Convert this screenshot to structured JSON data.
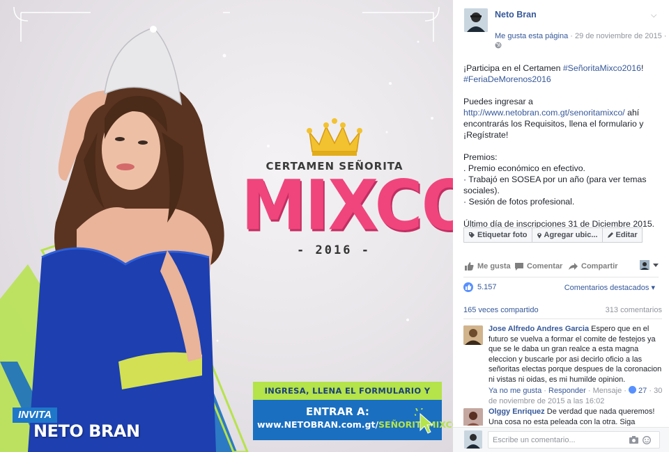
{
  "photo": {
    "certamen_title": "CERTAMEN SEÑORITA",
    "mixco_word": "MIXCO",
    "year": "- 2016 -",
    "ingresa_band": "INGRESA, LLENA EL FORMULARIO Y ¡REGÍSTRATE!",
    "entrar_label": "ENTRAR A:",
    "entrar_url_prefix": "www.NETOBRAN.com.gt/",
    "entrar_url_highlight": "SEÑORITAMIXCO",
    "invita_label": "INVITA",
    "neto_bran_label": "NETO BRAN",
    "colors": {
      "pink": "#f0457c",
      "blue": "#1a6fc0",
      "lime": "#b4e34a",
      "crown_gold": "#f2c230"
    }
  },
  "post": {
    "author": "Neto Bran",
    "like_page": "Me gusta esta página",
    "date": " · 29 de noviembre de 2015 · ",
    "privacy_icon": "globe-icon",
    "text": {
      "line1_prefix": "¡Participa en el Certamen ",
      "hashtag1": "#SeñoritaMixco2016",
      "line1_suffix": "! ",
      "hashtag2": "#FeriaDeMorenos2016",
      "p2_prefix": "Puedes ingresar a ",
      "p2_link": "http://www.netobran.com.gt/senoritamixco/",
      "p2_suffix": " ahí encontrarás los Requisitos, llena el formulario y ¡Regístrate!",
      "premios_title": "Premios:",
      "premio1": ". Premio económico en efectivo.",
      "premio2": "· Trabajó en SOSEA por un año (para ver temas sociales).",
      "premio3": "· Sesión de fotos profesional.",
      "last_day": "Último día de inscripciones 31 de Diciembre 2015."
    },
    "tag_buttons": [
      "Etiquetar foto",
      "Agregar ubic...",
      "Editar"
    ],
    "actions": {
      "like": "Me gusta",
      "comment": "Comentar",
      "share": "Compartir"
    },
    "likes_count": "5.157",
    "comments_filter": "Comentarios destacados",
    "shares": "165 veces compartido",
    "comments_total": "313 comentarios"
  },
  "comments": [
    {
      "name": "Jose Alfredo Andres Garcia",
      "text": "Espero que en el futuro se vuelva a formar el comite de festejos ya que se le daba un gran realce a esta magna eleccion y buscarle por asi decirlo oficio a las señoritas electas porque despues de la coronacion ni vistas ni oidas, es mi humilde opinion.",
      "meta_unlike": "Ya no me gusta",
      "meta_reply": "Responder",
      "meta_message": "Mensaje",
      "meta_likes": "27",
      "meta_date": "30 de noviembre de 2015 a las 16:02"
    },
    {
      "name": "Olggy Enriquez",
      "text": "De verdad que nada queremos! Una cosa no esta peleada con la otra. Siga"
    }
  ],
  "composer": {
    "placeholder": "Escribe un comentario..."
  }
}
